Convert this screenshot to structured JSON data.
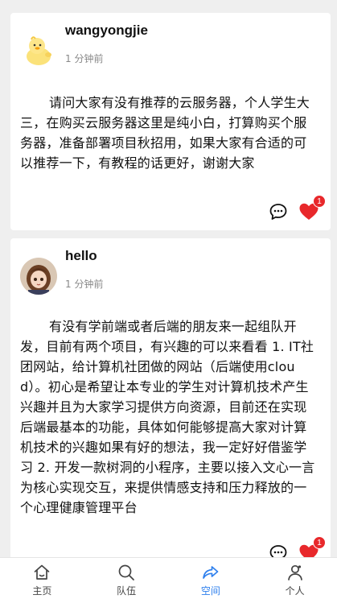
{
  "posts": [
    {
      "username": "wangyongjie",
      "time": "1 分钟前",
      "content": "请问大家有没有推荐的云服务器，个人学生大三，在购买云服务器这里是纯小白，打算购买个服务器，准备部署项目秋招用，如果大家有合适的可以推荐一下，有教程的话更好，谢谢大家",
      "like_count": "1",
      "avatar_icon": "duck-avatar-icon"
    },
    {
      "username": "hello",
      "time": "1 分钟前",
      "content": "有没有学前端或者后端的朋友来一起组队开发，目前有两个项目，有兴趣的可以来看看 1. IT社团网站，给计算机社团做的网站（后端使用cloud）。初心是希望让本专业的学生对计算机技术产生兴趣并且为大家学习提供方向资源，目前还在实现后端最基本的功能，具体如何能够提高大家对计算机技术的兴趣如果有好的想法，我一定好好借鉴学习 2. 开发一款树洞的小程序，主要以接入文心一言为核心实现交互，来提供情感支持和压力释放的一个心理健康管理平台",
      "like_count": "1",
      "avatar_icon": "anime-girl-avatar-icon"
    }
  ],
  "tabbar": {
    "items": [
      {
        "label": "主页",
        "icon": "home-icon"
      },
      {
        "label": "队伍",
        "icon": "search-icon"
      },
      {
        "label": "空间",
        "icon": "share-icon"
      },
      {
        "label": "个人",
        "icon": "user-icon"
      }
    ],
    "active_index": 2,
    "active_color": "#2f80ed"
  },
  "colors": {
    "like": "#e8282b",
    "background": "#efefef"
  }
}
